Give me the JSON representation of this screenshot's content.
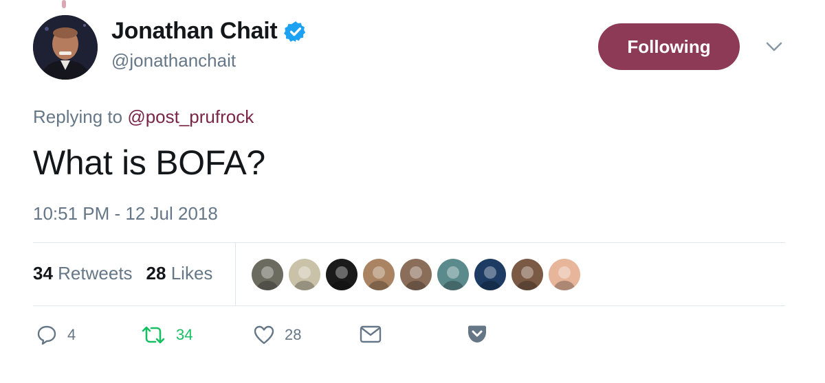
{
  "author": {
    "display_name": "Jonathan Chait",
    "handle": "@jonathanchait",
    "verified_icon": "verified-badge-icon"
  },
  "follow_button": {
    "label": "Following",
    "color": "#8d3a56"
  },
  "reply": {
    "prefix": "Replying to",
    "mention": "@post_prufrock"
  },
  "tweet": {
    "text": "What is BOFA?",
    "timestamp": "10:51 PM - 12 Jul 2018"
  },
  "stats": {
    "retweets_count": "34",
    "retweets_label": "Retweets",
    "likes_count": "28",
    "likes_label": "Likes"
  },
  "likers": [
    {
      "icon": "liker-avatar-1",
      "color": "#6b6b60"
    },
    {
      "icon": "liker-avatar-2",
      "color": "#c9c2a8"
    },
    {
      "icon": "liker-avatar-3",
      "color": "#1a1a1a"
    },
    {
      "icon": "liker-avatar-4",
      "color": "#a98362"
    },
    {
      "icon": "liker-avatar-5",
      "color": "#8a6e5a"
    },
    {
      "icon": "liker-avatar-6",
      "color": "#5b8a8d"
    },
    {
      "icon": "liker-avatar-7",
      "color": "#1d3b63"
    },
    {
      "icon": "liker-avatar-8",
      "color": "#7a5a44"
    },
    {
      "icon": "liker-avatar-9",
      "color": "#e6b59a"
    }
  ],
  "actions": {
    "reply_count": "4",
    "retweet_count": "34",
    "like_count": "28"
  },
  "colors": {
    "accent": "#8d3a56",
    "mention": "#7a2446",
    "retweet_green": "#17bf63",
    "muted": "#657786"
  }
}
